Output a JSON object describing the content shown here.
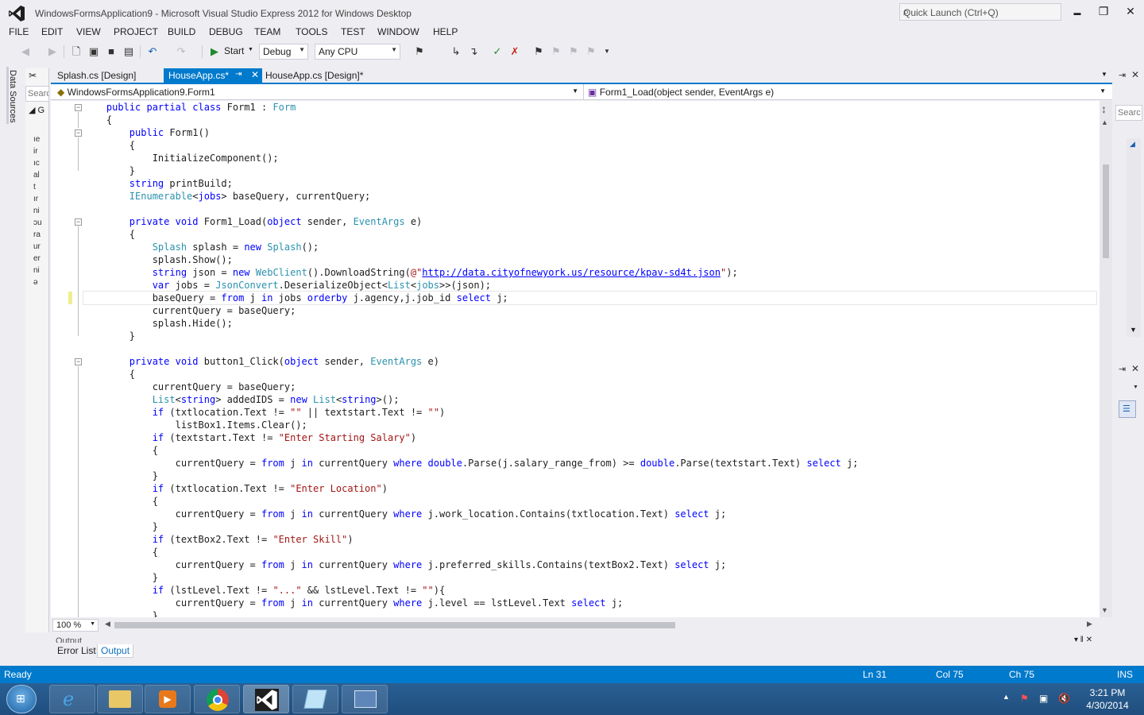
{
  "window": {
    "title": "WindowsFormsApplication9 - Microsoft Visual Studio Express 2012 for Windows Desktop",
    "quick_launch_placeholder": "Quick Launch (Ctrl+Q)",
    "minimize": "▬",
    "restore": "❐",
    "close": "✕"
  },
  "menu": [
    "FILE",
    "EDIT",
    "VIEW",
    "PROJECT",
    "BUILD",
    "DEBUG",
    "TEAM",
    "TOOLS",
    "TEST",
    "WINDOW",
    "HELP"
  ],
  "toolbar": {
    "start_label": "Start",
    "config": "Debug",
    "platform": "Any CPU"
  },
  "left_strip": {
    "label": "Data Sources"
  },
  "data_sources": {
    "search_placeholder": "Searc",
    "node_label": "G",
    "fragments": [
      "ıe",
      "ir",
      "ıc",
      "al",
      "t",
      "ır",
      "ni",
      "ɔu",
      "ra",
      "ur",
      "er",
      "ni",
      "ə"
    ]
  },
  "doc_tabs": [
    {
      "label": "Splash.cs [Design]"
    },
    {
      "label": "HouseApp.cs*"
    },
    {
      "label": "HouseApp.cs [Design]*"
    }
  ],
  "navbar": {
    "class_combo": "WindowsFormsApplication9.Form1",
    "member_combo": "Form1_Load(object sender, EventArgs e)"
  },
  "editor": {
    "current_line_index": 15,
    "lines": [
      [
        [
          "    ",
          ""
        ],
        [
          "public partial class ",
          "kw"
        ],
        [
          "Form1 : ",
          ""
        ],
        [
          "Form",
          "ty"
        ]
      ],
      [
        [
          "    {",
          ""
        ]
      ],
      [
        [
          "        ",
          ""
        ],
        [
          "public ",
          "kw"
        ],
        [
          "Form1()",
          ""
        ]
      ],
      [
        [
          "        {",
          ""
        ]
      ],
      [
        [
          "            InitializeComponent();",
          ""
        ]
      ],
      [
        [
          "        }",
          ""
        ]
      ],
      [
        [
          "        ",
          ""
        ],
        [
          "string ",
          "kw"
        ],
        [
          "printBuild;",
          ""
        ]
      ],
      [
        [
          "        ",
          ""
        ],
        [
          "IEnumerable",
          "ty"
        ],
        [
          "<",
          ""
        ],
        [
          "jobs",
          "kw"
        ],
        [
          "> baseQuery, currentQuery;",
          ""
        ]
      ],
      [
        [
          "",
          ""
        ]
      ],
      [
        [
          "        ",
          ""
        ],
        [
          "private void ",
          "kw"
        ],
        [
          "Form1_Load(",
          ""
        ],
        [
          "object ",
          "kw"
        ],
        [
          "sender, ",
          ""
        ],
        [
          "EventArgs ",
          "ty"
        ],
        [
          "e)",
          ""
        ]
      ],
      [
        [
          "        {",
          ""
        ]
      ],
      [
        [
          "            ",
          ""
        ],
        [
          "Splash ",
          "ty"
        ],
        [
          "splash = ",
          ""
        ],
        [
          "new ",
          "kw"
        ],
        [
          "Splash",
          "ty"
        ],
        [
          "();",
          ""
        ]
      ],
      [
        [
          "            splash.Show();",
          ""
        ]
      ],
      [
        [
          "            ",
          ""
        ],
        [
          "string ",
          "kw"
        ],
        [
          "json = ",
          ""
        ],
        [
          "new ",
          "kw"
        ],
        [
          "WebClient",
          "ty"
        ],
        [
          "().DownloadString(",
          ""
        ],
        [
          "@\"",
          "st"
        ],
        [
          "http://data.cityofnewyork.us/resource/kpav-sd4t.json",
          "url"
        ],
        [
          "\"",
          "st"
        ],
        [
          ");",
          ""
        ]
      ],
      [
        [
          "            ",
          ""
        ],
        [
          "var ",
          "kw"
        ],
        [
          "jobs = ",
          ""
        ],
        [
          "JsonConvert",
          "ty"
        ],
        [
          ".DeserializeObject<",
          ""
        ],
        [
          "List",
          "ty"
        ],
        [
          "<",
          ""
        ],
        [
          "jobs",
          "ty"
        ],
        [
          ">>(json);",
          ""
        ]
      ],
      [
        [
          "            baseQuery = ",
          ""
        ],
        [
          "from ",
          "kw"
        ],
        [
          "j ",
          ""
        ],
        [
          "in ",
          "kw"
        ],
        [
          "jobs ",
          ""
        ],
        [
          "orderby ",
          "kw"
        ],
        [
          "j.agency,j.job_id ",
          ""
        ],
        [
          "select ",
          "kw"
        ],
        [
          "j;",
          ""
        ]
      ],
      [
        [
          "            currentQuery = baseQuery;",
          ""
        ]
      ],
      [
        [
          "            splash.Hide();",
          ""
        ]
      ],
      [
        [
          "        }",
          ""
        ]
      ],
      [
        [
          "",
          ""
        ]
      ],
      [
        [
          "        ",
          ""
        ],
        [
          "private void ",
          "kw"
        ],
        [
          "button1_Click(",
          ""
        ],
        [
          "object ",
          "kw"
        ],
        [
          "sender, ",
          ""
        ],
        [
          "EventArgs ",
          "ty"
        ],
        [
          "e)",
          ""
        ]
      ],
      [
        [
          "        {",
          ""
        ]
      ],
      [
        [
          "            currentQuery = baseQuery;",
          ""
        ]
      ],
      [
        [
          "            ",
          ""
        ],
        [
          "List",
          "ty"
        ],
        [
          "<",
          ""
        ],
        [
          "string",
          "kw"
        ],
        [
          "> addedIDS = ",
          ""
        ],
        [
          "new ",
          "kw"
        ],
        [
          "List",
          "ty"
        ],
        [
          "<",
          ""
        ],
        [
          "string",
          "kw"
        ],
        [
          ">();",
          ""
        ]
      ],
      [
        [
          "            ",
          ""
        ],
        [
          "if ",
          "kw"
        ],
        [
          "(txtlocation.Text != ",
          ""
        ],
        [
          "\"\"",
          "st"
        ],
        [
          " || textstart.Text != ",
          ""
        ],
        [
          "\"\"",
          "st"
        ],
        [
          ")",
          ""
        ]
      ],
      [
        [
          "                listBox1.Items.Clear();",
          ""
        ]
      ],
      [
        [
          "            ",
          ""
        ],
        [
          "if ",
          "kw"
        ],
        [
          "(textstart.Text != ",
          ""
        ],
        [
          "\"Enter Starting Salary\"",
          "st"
        ],
        [
          ")",
          ""
        ]
      ],
      [
        [
          "            {",
          ""
        ]
      ],
      [
        [
          "                currentQuery = ",
          ""
        ],
        [
          "from ",
          "kw"
        ],
        [
          "j ",
          ""
        ],
        [
          "in ",
          "kw"
        ],
        [
          "currentQuery ",
          ""
        ],
        [
          "where ",
          "kw"
        ],
        [
          "double",
          "kw"
        ],
        [
          ".Parse(j.salary_range_from) >= ",
          ""
        ],
        [
          "double",
          "kw"
        ],
        [
          ".Parse(textstart.Text) ",
          ""
        ],
        [
          "select ",
          "kw"
        ],
        [
          "j;",
          ""
        ]
      ],
      [
        [
          "            }",
          ""
        ]
      ],
      [
        [
          "            ",
          ""
        ],
        [
          "if ",
          "kw"
        ],
        [
          "(txtlocation.Text != ",
          ""
        ],
        [
          "\"Enter Location\"",
          "st"
        ],
        [
          ")",
          ""
        ]
      ],
      [
        [
          "            {",
          ""
        ]
      ],
      [
        [
          "                currentQuery = ",
          ""
        ],
        [
          "from ",
          "kw"
        ],
        [
          "j ",
          ""
        ],
        [
          "in ",
          "kw"
        ],
        [
          "currentQuery ",
          ""
        ],
        [
          "where ",
          "kw"
        ],
        [
          "j.work_location.Contains(txtlocation.Text) ",
          ""
        ],
        [
          "select ",
          "kw"
        ],
        [
          "j;",
          ""
        ]
      ],
      [
        [
          "            }",
          ""
        ]
      ],
      [
        [
          "            ",
          ""
        ],
        [
          "if ",
          "kw"
        ],
        [
          "(textBox2.Text != ",
          ""
        ],
        [
          "\"Enter Skill\"",
          "st"
        ],
        [
          ")",
          ""
        ]
      ],
      [
        [
          "            {",
          ""
        ]
      ],
      [
        [
          "                currentQuery = ",
          ""
        ],
        [
          "from ",
          "kw"
        ],
        [
          "j ",
          ""
        ],
        [
          "in ",
          "kw"
        ],
        [
          "currentQuery ",
          ""
        ],
        [
          "where ",
          "kw"
        ],
        [
          "j.preferred_skills.Contains(textBox2.Text) ",
          ""
        ],
        [
          "select ",
          "kw"
        ],
        [
          "j;",
          ""
        ]
      ],
      [
        [
          "            }",
          ""
        ]
      ],
      [
        [
          "            ",
          ""
        ],
        [
          "if ",
          "kw"
        ],
        [
          "(lstLevel.Text != ",
          ""
        ],
        [
          "\"...\"",
          "st"
        ],
        [
          " && lstLevel.Text != ",
          ""
        ],
        [
          "\"\"",
          "st"
        ],
        [
          "){",
          ""
        ]
      ],
      [
        [
          "                currentQuery = ",
          ""
        ],
        [
          "from ",
          "kw"
        ],
        [
          "j ",
          ""
        ],
        [
          "in ",
          "kw"
        ],
        [
          "currentQuery ",
          ""
        ],
        [
          "where ",
          "kw"
        ],
        [
          "j.level == lstLevel.Text ",
          ""
        ],
        [
          "select ",
          "kw"
        ],
        [
          "j;",
          ""
        ]
      ],
      [
        [
          "            }",
          ""
        ]
      ]
    ]
  },
  "zoom": "100 %",
  "right_panel": {
    "search_placeholder": "Searc"
  },
  "output": {
    "title": "Output",
    "tabs": [
      {
        "label": "Error List"
      },
      {
        "label": "Output"
      }
    ]
  },
  "status": {
    "ready": "Ready",
    "ln": "Ln 31",
    "col": "Col 75",
    "ch": "Ch 75",
    "ins": "INS"
  },
  "taskbar": {
    "time": "3:21 PM",
    "date": "4/30/2014"
  },
  "colors": {
    "accent": "#007acc",
    "keyword": "#0000ff",
    "type": "#2b91af",
    "string": "#a31515"
  }
}
